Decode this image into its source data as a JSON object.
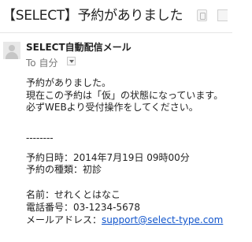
{
  "email": {
    "subject": "【SELECT】予約がありました",
    "sender_name": "SELECT自動配信メール",
    "to_label": "To 自分",
    "body": {
      "line1": "予約がありました。",
      "line2": "現在この予約は「仮」の状態になっています。",
      "line3": "必ずWEBより受付操作をしてください。",
      "separator": "--------",
      "date_line": "予約日時：2014年7月19日 09時00分",
      "type_line": "予約の種類：初診",
      "name_line": "名前：せれくとはなこ",
      "phone_line": "電話番号：03-1234-5678",
      "email_label": "メールアドレス：",
      "email_link": "support@select-type.com"
    }
  },
  "icons": {
    "inbox": "inbox-label-icon",
    "print": "print-icon",
    "avatar": "default-avatar-icon",
    "dropdown": "dropdown-arrow-icon"
  },
  "colors": {
    "link": "#1155cc",
    "muted": "#777777",
    "text": "#222222"
  }
}
